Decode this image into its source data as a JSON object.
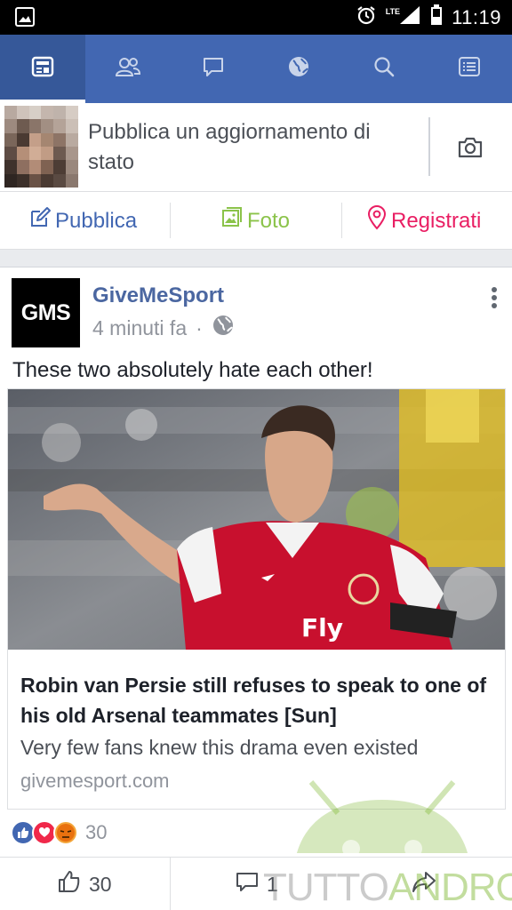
{
  "status_bar": {
    "time": "11:19",
    "network": "LTE",
    "icons": [
      "image-icon",
      "alarm-icon",
      "signal-icon",
      "battery-icon"
    ]
  },
  "nav": {
    "tabs": [
      {
        "name": "news-feed",
        "icon": "news-feed-icon",
        "active": true
      },
      {
        "name": "friends",
        "icon": "friends-icon",
        "active": false
      },
      {
        "name": "messages",
        "icon": "chat-bubble-icon",
        "active": false
      },
      {
        "name": "notifications",
        "icon": "globe-icon",
        "active": false
      },
      {
        "name": "search",
        "icon": "search-icon",
        "active": false
      },
      {
        "name": "menu",
        "icon": "menu-list-icon",
        "active": false
      }
    ],
    "bar_color": "#4267b2"
  },
  "composer": {
    "prompt": "Pubblica un aggiornamento di stato",
    "actions": {
      "post": "Pubblica",
      "photo": "Foto",
      "checkin": "Registrati"
    },
    "action_colors": {
      "post": "#4267b2",
      "photo": "#8bc34a",
      "checkin": "#e91e63"
    }
  },
  "post": {
    "page_avatar_text": "GMS",
    "page_name": "GiveMeSport",
    "time": "4 minuti fa",
    "separator": "·",
    "caption": "These two absolutely hate each other!",
    "link": {
      "headline": "Robin van Persie still refuses to speak to one of his old Arsenal teammates [Sun]",
      "description": "Very few fans knew this drama even existed",
      "domain": "givemesport.com"
    },
    "reactions": {
      "types": [
        "like",
        "love",
        "angry"
      ],
      "count": "30"
    },
    "footer": {
      "likes": "30",
      "comments": "1"
    }
  },
  "watermark": {
    "part1": "TUTTO",
    "part2": "ANDROID"
  }
}
